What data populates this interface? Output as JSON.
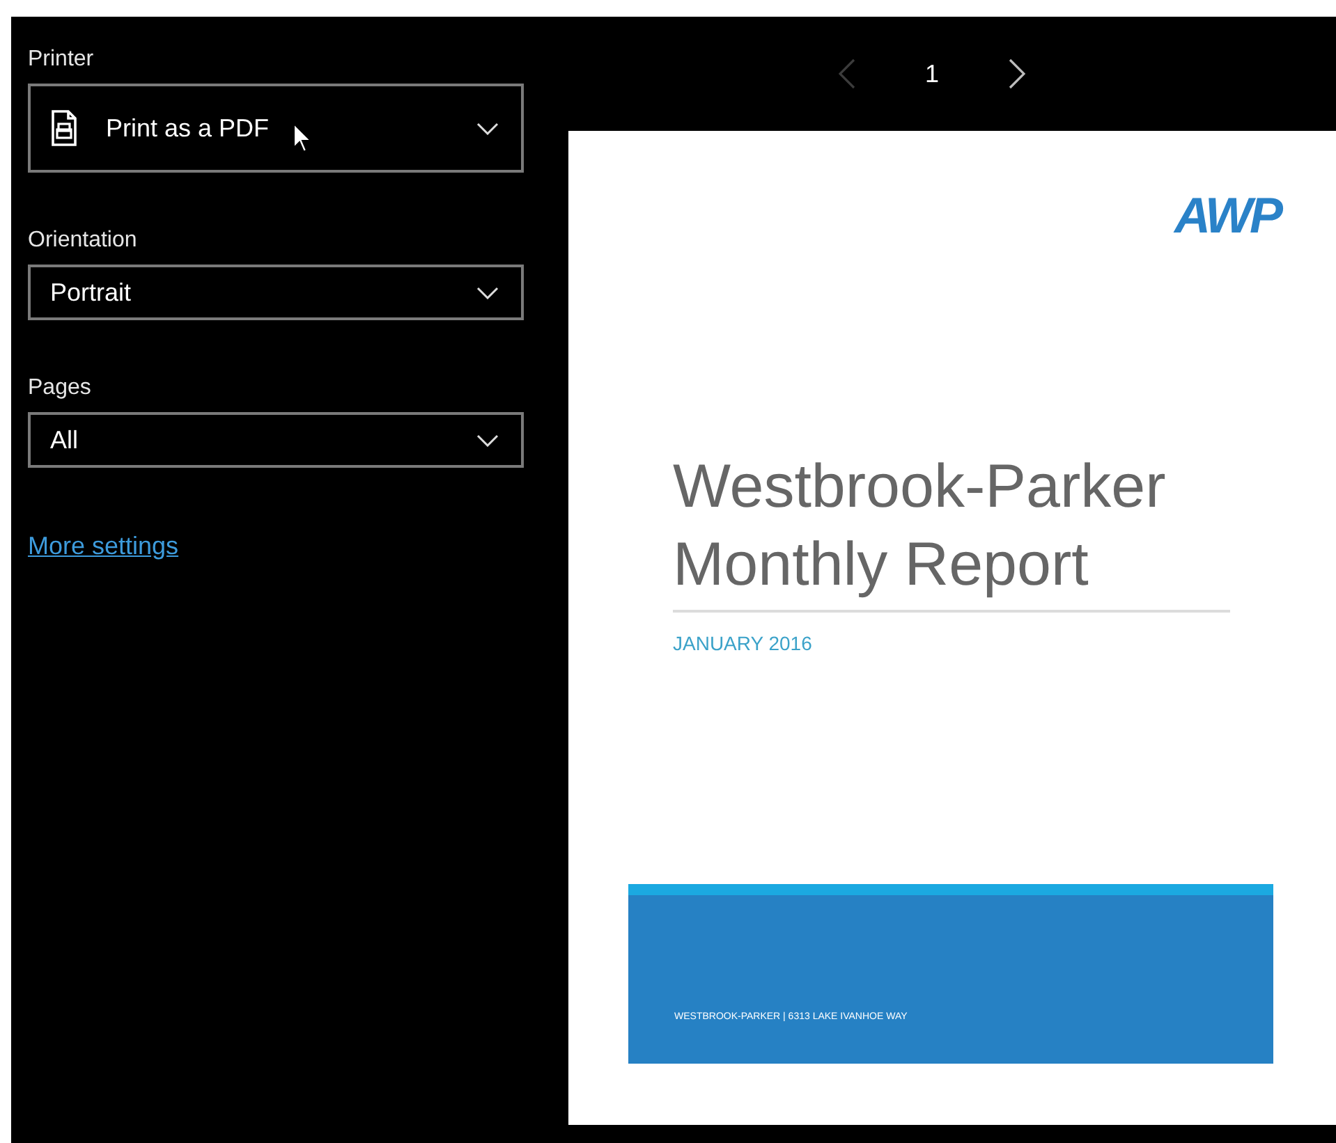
{
  "settings": [
    {
      "kind": "device",
      "label": "Printer",
      "value": "Print as a PDF"
    },
    {
      "kind": "plain",
      "label": "Orientation",
      "value": "Portrait"
    },
    {
      "kind": "plain",
      "label": "Pages",
      "value": "All"
    }
  ],
  "more_settings_link": "More settings",
  "pager": {
    "page": "1",
    "previous": {
      "disabled": true
    },
    "next": {
      "disabled": false
    }
  },
  "preview": {
    "logo": "AWP",
    "title_lines": [
      "Westbrook-Parker",
      "Monthly Report"
    ],
    "date": "JANUARY 2016",
    "footer": "WESTBROOK-PARKER | 6313 LAKE IVANHOE WAY"
  }
}
